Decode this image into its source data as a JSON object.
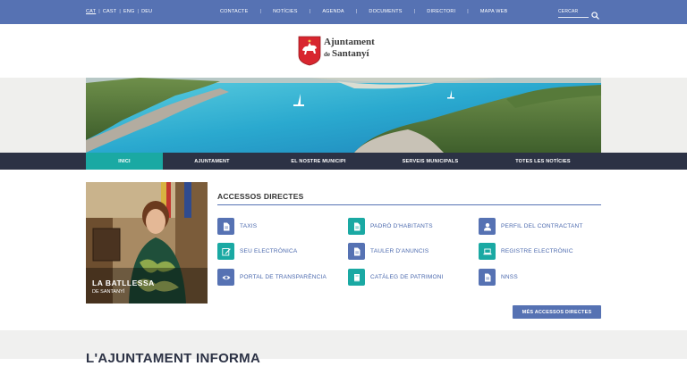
{
  "topbar": {
    "languages": [
      "CAT",
      "CAST",
      "ENG",
      "DEU"
    ],
    "active_language": "CAT",
    "links": [
      "CONTACTE",
      "NOTÍCIES",
      "AGENDA",
      "DOCUMENTS",
      "DIRECTORI",
      "MAPA WEB"
    ],
    "search_label": "CERCAR",
    "search_icon": "magnifier-icon"
  },
  "logo": {
    "line1": "Ajuntament",
    "line2_prefix": "de",
    "line2": "Santanyí"
  },
  "mainnav": {
    "tabs": [
      "INICI",
      "AJUNTAMENT",
      "EL NOSTRE MUNICIPI",
      "SERVEIS MUNICIPALS",
      "TOTES LES NOTÍCIES"
    ],
    "active_tab": "INICI"
  },
  "mayor": {
    "title": "LA BATLLESSA",
    "subtitle": "DE SANTANYÍ"
  },
  "accessos": {
    "title": "ACCESSOS DIRECTES",
    "items": [
      {
        "label": "TAXIS",
        "icon": "document-icon",
        "color": "blue"
      },
      {
        "label": "PADRÓ D'HABITANTS",
        "icon": "document-icon",
        "color": "teal"
      },
      {
        "label": "PERFIL DEL CONTRACTANT",
        "icon": "user-icon",
        "color": "blue"
      },
      {
        "label": "SEU ELECTRÒNICA",
        "icon": "edit-icon",
        "color": "teal"
      },
      {
        "label": "TAULER D'ANUNCIS",
        "icon": "document-icon",
        "color": "blue"
      },
      {
        "label": "REGISTRE ELECTRÒNIC",
        "icon": "laptop-icon",
        "color": "teal"
      },
      {
        "label": "PORTAL DE TRANSPARÈNCIA",
        "icon": "eye-icon",
        "color": "blue"
      },
      {
        "label": "CATÀLEG DE PATRIMONI",
        "icon": "book-icon",
        "color": "teal"
      },
      {
        "label": "NNSS",
        "icon": "document-icon",
        "color": "blue"
      }
    ],
    "more_button": "MÉS ACCESSOS DIRECTES"
  },
  "info": {
    "title": "L'AJUNTAMENT INFORMA"
  },
  "colors": {
    "primary_blue": "#5672b3",
    "teal": "#1aa9a3",
    "dark_nav": "#2c3245"
  }
}
